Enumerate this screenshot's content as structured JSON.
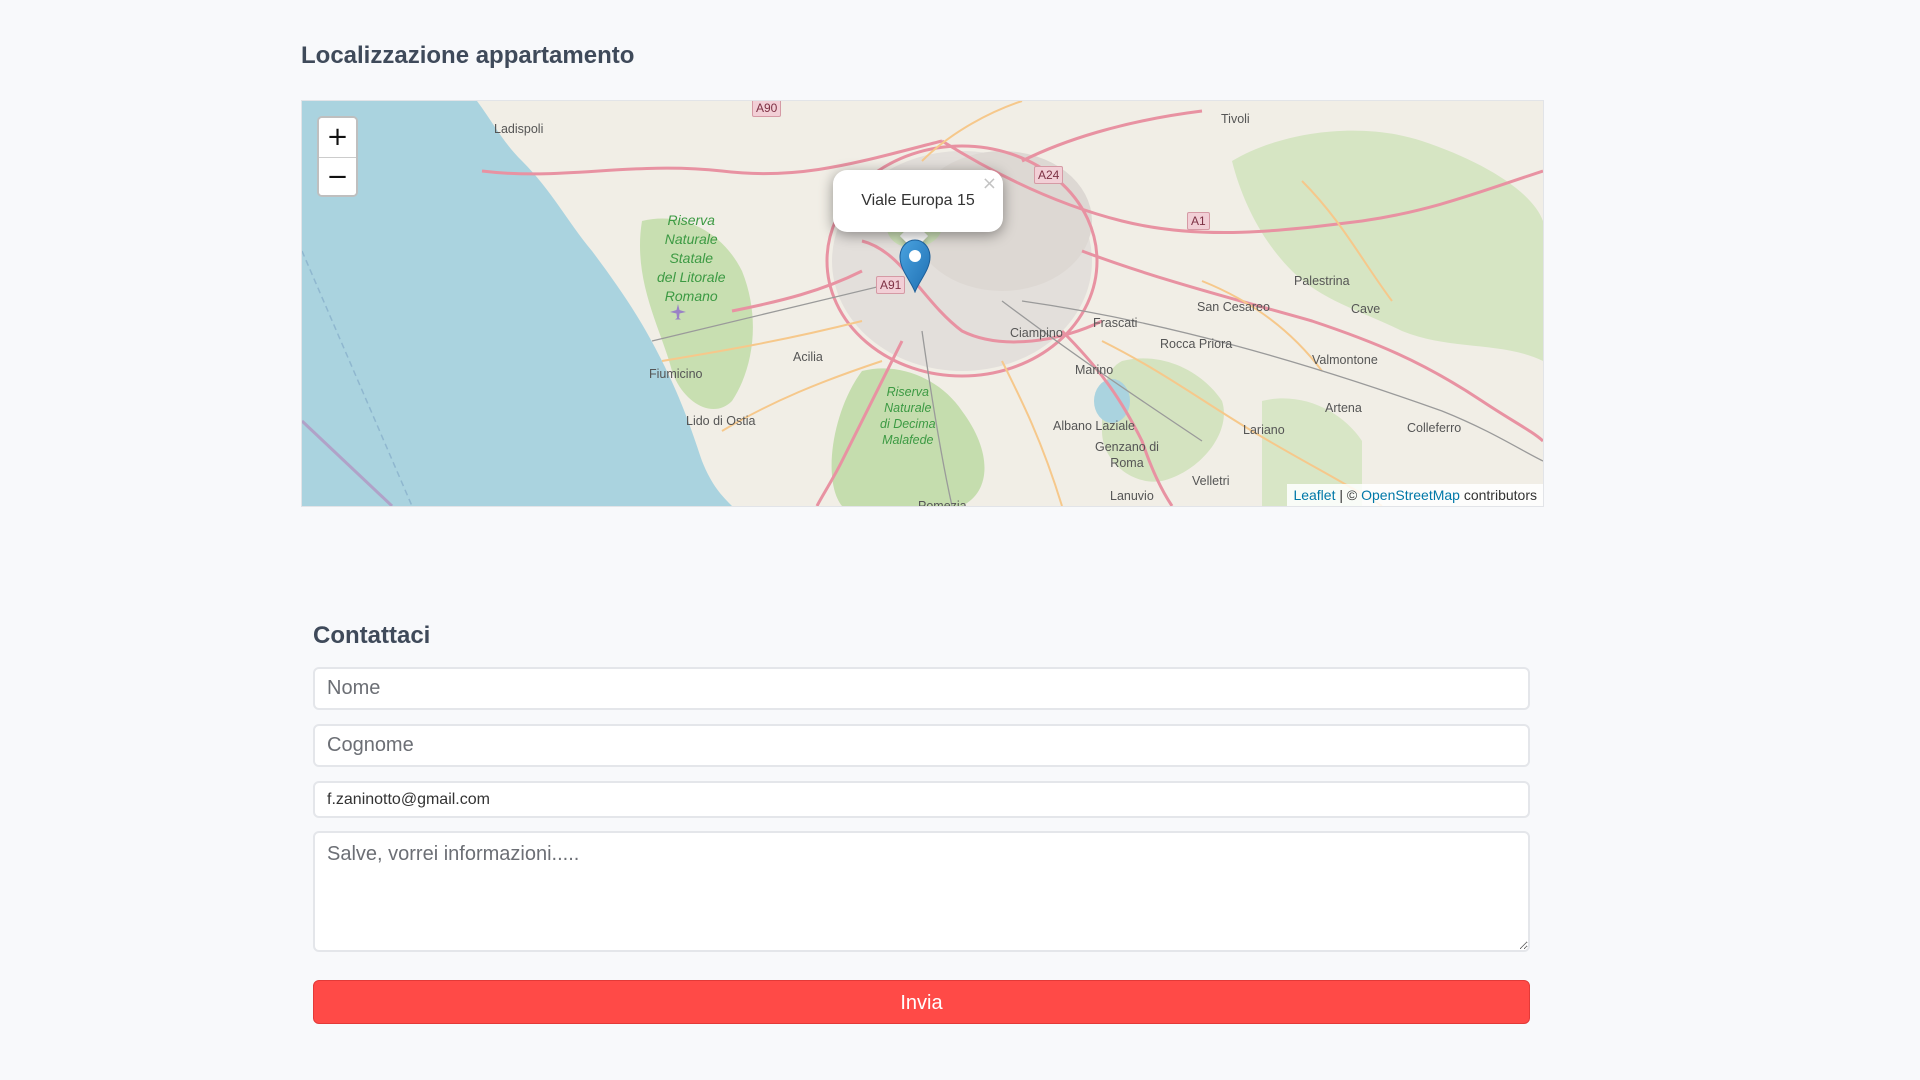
{
  "map_section": {
    "title": "Localizzazione appartamento",
    "zoom_in": "+",
    "zoom_out": "−",
    "popup_text": "Viale Europa 15",
    "popup_close": "×",
    "attribution": {
      "leaflet": "Leaflet",
      "separator": " | © ",
      "osm": "OpenStreetMap",
      "suffix": " contributors"
    },
    "places": {
      "ladispoli": "Ladispoli",
      "tivoli": "Tivoli",
      "fiumicino": "Fiumicino",
      "acilia": "Acilia",
      "lido_di_ostia": "Lido di Ostia",
      "ciampino": "Ciampino",
      "frascati": "Frascati",
      "marino": "Marino",
      "albano_laziale": "Albano Laziale",
      "genzano": "Genzano di\nRoma",
      "lanuvio": "Lanuvio",
      "velletri": "Velletri",
      "lariano": "Lariano",
      "rocca_priora": "Rocca Priora",
      "san_cesareo": "San Cesareo",
      "palestrina": "Palestrina",
      "cave": "Cave",
      "valmontone": "Valmontone",
      "artena": "Artena",
      "colleferro": "Colleferro",
      "pomezia": "Pomezia",
      "riserva_litorale": "Riserva\nNaturale\nStatale\ndel Litorale\nRomano",
      "riserva_decima": "Riserva\nNaturale\ndi Decima\nMalafede"
    },
    "roads": {
      "a90": "A90",
      "a24": "A24",
      "a1": "A1",
      "a91": "A91"
    },
    "colors": {
      "sea": "#aad3df",
      "land": "#f1eee6",
      "park": "#c8dfb1",
      "motorway": "#e892a2",
      "road": "#f9c784"
    }
  },
  "contact": {
    "title": "Contattaci",
    "nome_placeholder": "Nome",
    "cognome_placeholder": "Cognome",
    "email_value": "f.zaninotto@gmail.com",
    "message_placeholder": "Salve, vorrei informazioni.....",
    "submit_label": "Invia",
    "submit_color": "#ff4a47"
  }
}
